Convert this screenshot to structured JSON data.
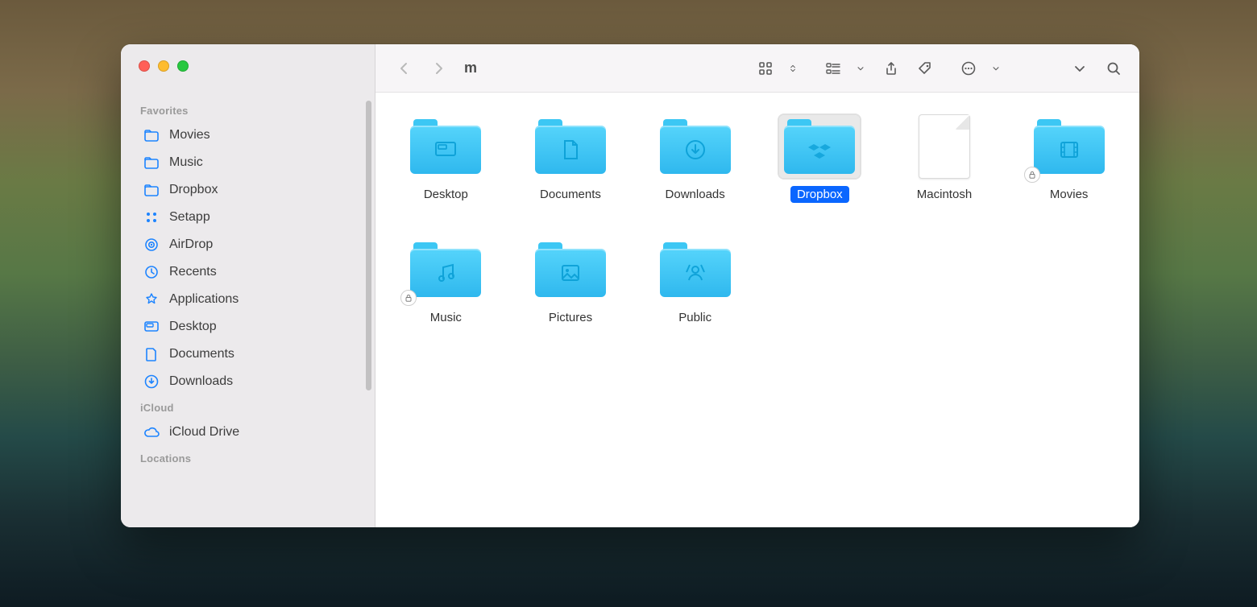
{
  "window": {
    "title": "m"
  },
  "sidebar": {
    "sections": [
      {
        "title": "Favorites",
        "items": [
          {
            "label": "Movies",
            "icon": "folder-icon"
          },
          {
            "label": "Music",
            "icon": "folder-icon"
          },
          {
            "label": "Dropbox",
            "icon": "folder-icon"
          },
          {
            "label": "Setapp",
            "icon": "setapp-icon"
          },
          {
            "label": "AirDrop",
            "icon": "airdrop-icon"
          },
          {
            "label": "Recents",
            "icon": "clock-icon"
          },
          {
            "label": "Applications",
            "icon": "app-icon"
          },
          {
            "label": "Desktop",
            "icon": "desktop-icon"
          },
          {
            "label": "Documents",
            "icon": "document-icon"
          },
          {
            "label": "Downloads",
            "icon": "download-icon"
          }
        ]
      },
      {
        "title": "iCloud",
        "items": [
          {
            "label": "iCloud Drive",
            "icon": "cloud-icon"
          }
        ]
      },
      {
        "title": "Locations",
        "items": []
      }
    ]
  },
  "toolbar": {
    "back": "Back",
    "forward": "Forward",
    "view": "Icon view",
    "group": "Group",
    "share": "Share",
    "tags": "Tags",
    "more": "More",
    "expand": "Expand",
    "search": "Search"
  },
  "items": [
    {
      "name": "Desktop",
      "type": "folder",
      "glyph": "desktop",
      "selected": false,
      "locked": false
    },
    {
      "name": "Documents",
      "type": "folder",
      "glyph": "document",
      "selected": false,
      "locked": false
    },
    {
      "name": "Downloads",
      "type": "folder",
      "glyph": "download",
      "selected": false,
      "locked": false
    },
    {
      "name": "Dropbox",
      "type": "folder",
      "glyph": "dropbox",
      "selected": true,
      "locked": false
    },
    {
      "name": "Macintosh",
      "type": "file",
      "glyph": "",
      "selected": false,
      "locked": false
    },
    {
      "name": "Movies",
      "type": "folder",
      "glyph": "movie",
      "selected": false,
      "locked": true
    },
    {
      "name": "Music",
      "type": "folder",
      "glyph": "music",
      "selected": false,
      "locked": true
    },
    {
      "name": "Pictures",
      "type": "folder",
      "glyph": "picture",
      "selected": false,
      "locked": false
    },
    {
      "name": "Public",
      "type": "folder",
      "glyph": "public",
      "selected": false,
      "locked": false
    }
  ]
}
